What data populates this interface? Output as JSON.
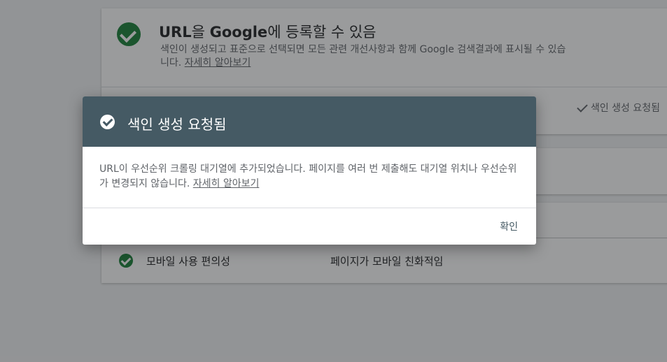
{
  "background": {
    "top_card": {
      "title_bold": "URL",
      "title_mid": "을 ",
      "title_bold2": "Google",
      "title_rest": "에 등록할 수 있음",
      "description": "색인이 생성되고 표준으로 선택되면 모든 관련 개선사항과 함께 Google 검색결과에 표시될 수 있습니다. ",
      "learn_more": "자세히 알아보기",
      "status": "색인 생성 요청됨"
    },
    "mobile_row": {
      "label": "모바일 사용 편의성",
      "value": "페이지가 모바일 친화적임"
    }
  },
  "dialog": {
    "title": "색인 생성 요청됨",
    "body": "URL이 우선순위 크롤링 대기열에 추가되었습니다. 페이지를 여러 번 제출해도 대기열 위치나 우선순위가 변경되지 않습니다. ",
    "learn_more": "자세히 알아보기",
    "ok_label": "확인"
  },
  "colors": {
    "header": "#455a64",
    "success": "#188038"
  }
}
